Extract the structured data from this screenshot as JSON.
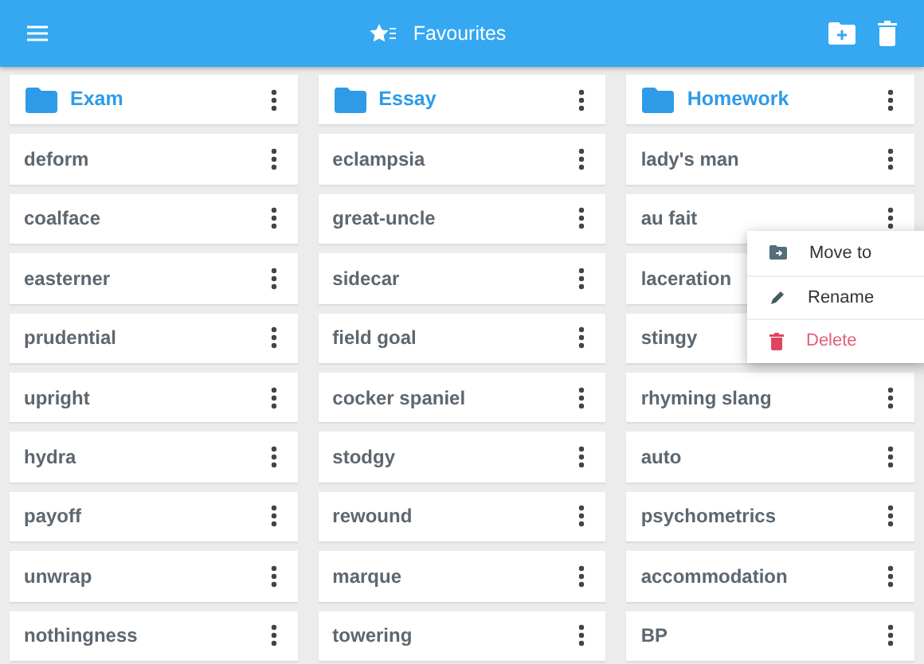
{
  "app_bar": {
    "title": "Favourites"
  },
  "folders": [
    {
      "name": "Exam",
      "items": [
        "deform",
        "coalface",
        "easterner",
        "prudential",
        "upright",
        "hydra",
        "payoff",
        "unwrap",
        "nothingness"
      ]
    },
    {
      "name": "Essay",
      "items": [
        "eclampsia",
        "great-uncle",
        "sidecar",
        "field goal",
        "cocker spaniel",
        "stodgy",
        "rewound",
        "marque",
        "towering"
      ]
    },
    {
      "name": "Homework",
      "items": [
        "lady's man",
        "au fait",
        "laceration",
        "stingy",
        "rhyming slang",
        "auto",
        "psychometrics",
        "accommodation",
        "BP"
      ]
    }
  ],
  "context_menu": [
    {
      "kind": "move",
      "label": "Move to"
    },
    {
      "kind": "rename",
      "label": "Rename"
    },
    {
      "kind": "delete",
      "label": "Delete"
    }
  ]
}
